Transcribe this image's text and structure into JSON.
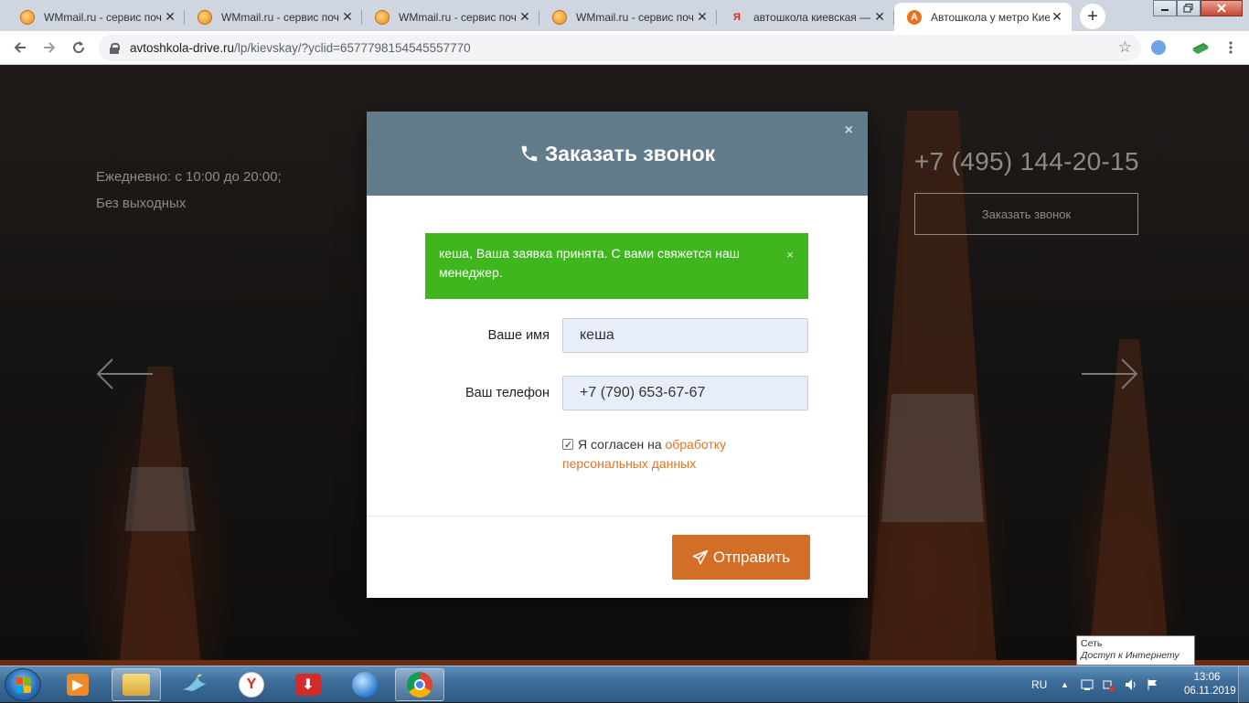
{
  "browser": {
    "tabs": [
      {
        "title": "WMmail.ru - сервис поч",
        "favicon": "wmmail-icon",
        "active": false
      },
      {
        "title": "WMmail.ru - сервис поч",
        "favicon": "wmmail-icon",
        "active": false
      },
      {
        "title": "WMmail.ru - сервис поч",
        "favicon": "wmmail-icon",
        "active": false
      },
      {
        "title": "WMmail.ru - сервис поч",
        "favicon": "wmmail-icon",
        "active": false
      },
      {
        "title": "автошкола киевская —",
        "favicon": "yandex-icon",
        "active": false
      },
      {
        "title": "Автошкола у метро Кие",
        "favicon": "avtoshkola-icon",
        "active": true
      }
    ],
    "tab_close_glyph": "✕",
    "new_tab_glyph": "+",
    "url_host": "avtoshkola-drive.ru",
    "url_path": "/lp/kievskay/?yclid=6577798154545557770"
  },
  "page": {
    "hours_line1": "Ежедневно: с 10:00 до 20:00;",
    "hours_line2": "Без выходных",
    "phone": "+7 (495) 144-20-15",
    "callback_button": "Заказать звонок"
  },
  "modal": {
    "title": "Заказать звонок",
    "close_glyph": "×",
    "alert_text": "кеша, Ваша заявка принята. С вами свяжется наш менеджер.",
    "alert_close_glyph": "×",
    "name_label": "Ваше имя",
    "name_value": "кеша",
    "phone_label": "Ваш телефон",
    "phone_value": "+7 (790) 653-67-67",
    "consent_prefix": "Я согласен на",
    "consent_link": "обработку персональных данных",
    "consent_checked": true,
    "submit_label": "Отправить"
  },
  "tooltip": {
    "title": "Сеть",
    "subtitle": "Доступ к Интернету"
  },
  "taskbar": {
    "language": "RU",
    "time": "13:06",
    "date": "06.11.2019"
  },
  "colors": {
    "modal_header": "#617b8b",
    "alert_success": "#3fb61e",
    "accent_orange": "#d36e27",
    "link_orange": "#e07427"
  }
}
